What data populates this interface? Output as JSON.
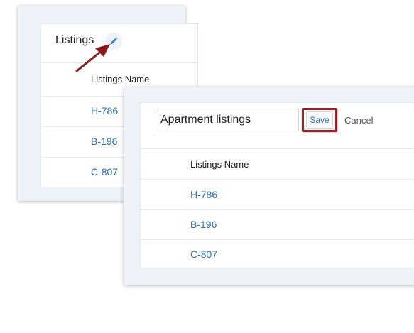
{
  "back_panel": {
    "title": "Listings",
    "column_header": "Listings Name",
    "rows": [
      "H-786",
      "B-196",
      "C-807"
    ]
  },
  "front_panel": {
    "input_value": "Apartment listings",
    "save_label": "Save",
    "cancel_label": "Cancel",
    "column_header": "Listings Name",
    "rows": [
      "H-786",
      "B-196",
      "C-807"
    ]
  },
  "colors": {
    "link": "#2f6fc2",
    "highlight": "#a11f24",
    "panel_bg": "#edf3f9"
  },
  "icons": {
    "edit": "pencil-icon",
    "annotation": "arrow-icon"
  }
}
